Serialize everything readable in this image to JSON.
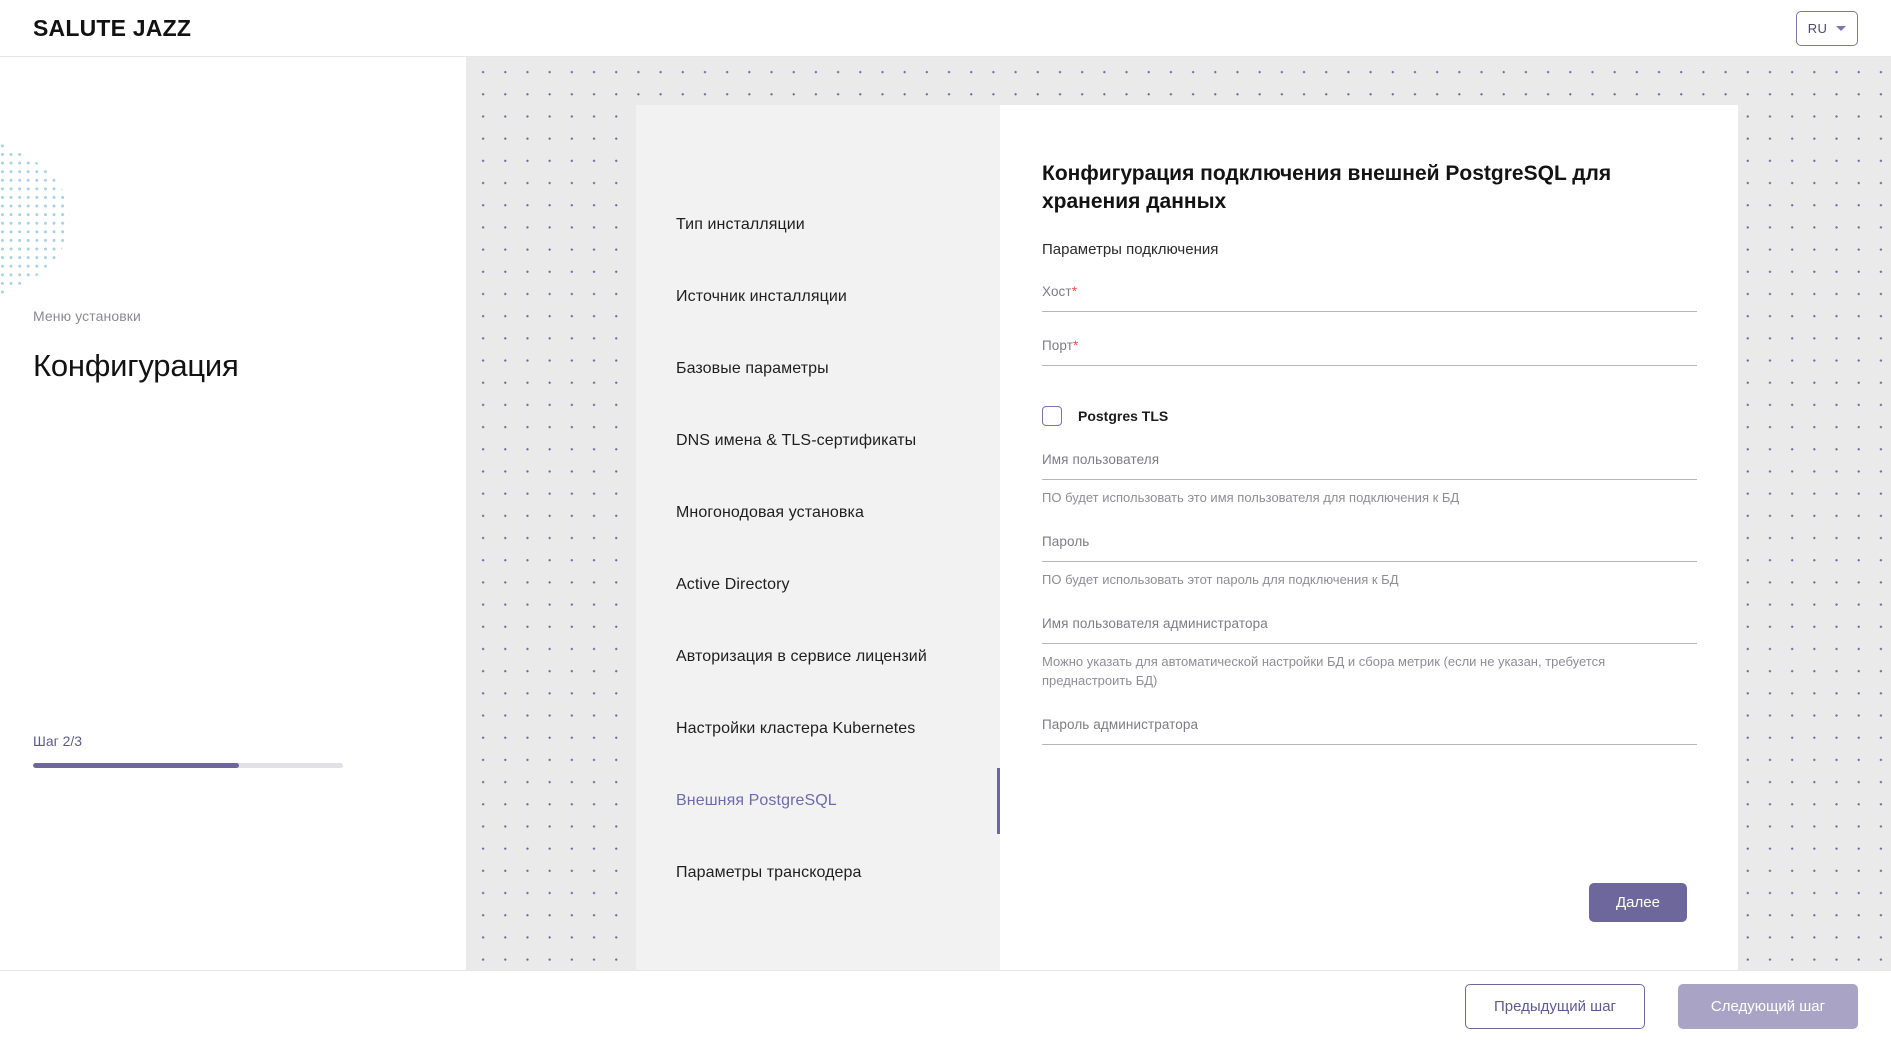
{
  "header": {
    "brand": "SALUTE JAZZ",
    "language": "RU"
  },
  "sidebar": {
    "caption": "Меню установки",
    "title": "Конфигурация",
    "progress": {
      "label": "Шаг 2/3",
      "current": 2,
      "total": 3,
      "percent": 66.6
    }
  },
  "menu": {
    "items": [
      {
        "label": "Тип инсталляции",
        "active": false
      },
      {
        "label": "Источник инсталляции",
        "active": false
      },
      {
        "label": "Базовые параметры",
        "active": false
      },
      {
        "label": "DNS имена & TLS-сертификаты",
        "active": false
      },
      {
        "label": "Многонодовая установка",
        "active": false
      },
      {
        "label": "Active Directory",
        "active": false
      },
      {
        "label": "Авторизация в сервисе лицензий",
        "active": false
      },
      {
        "label": "Настройки кластера Kubernetes",
        "active": false
      },
      {
        "label": "Внешняя PostgreSQL",
        "active": true
      },
      {
        "label": "Параметры транскодера",
        "active": false
      }
    ]
  },
  "form": {
    "title": "Конфигурация подключения внешней PostgreSQL для хранения данных",
    "subtitle": "Параметры подключения",
    "fields": [
      {
        "label": "Хост",
        "required": true,
        "value": "",
        "hint": ""
      },
      {
        "label": "Порт",
        "required": true,
        "value": "",
        "hint": ""
      },
      {
        "label": "Имя пользователя",
        "required": false,
        "value": "",
        "hint": "ПО будет использовать это имя пользователя для подключения к БД"
      },
      {
        "label": "Пароль",
        "required": false,
        "value": "",
        "hint": "ПО будет использовать этот пароль для подключения к БД"
      },
      {
        "label": "Имя пользователя администратора",
        "required": false,
        "value": "",
        "hint": "Можно указать для автоматической настройки БД и сбора метрик (если не указан, требуется преднастроить БД)"
      },
      {
        "label": "Пароль администратора",
        "required": false,
        "value": "",
        "hint": ""
      }
    ],
    "checkbox": {
      "label": "Postgres TLS",
      "checked": false
    },
    "submit_label": "Далее"
  },
  "footer": {
    "prev_label": "Предыдущий шаг",
    "next_label": "Следующий шаг"
  },
  "colors": {
    "accent": "#6e679b",
    "accent_light": "#a9a4c6",
    "required": "#ef4b4b",
    "dot_art": "#a9d2e4"
  }
}
